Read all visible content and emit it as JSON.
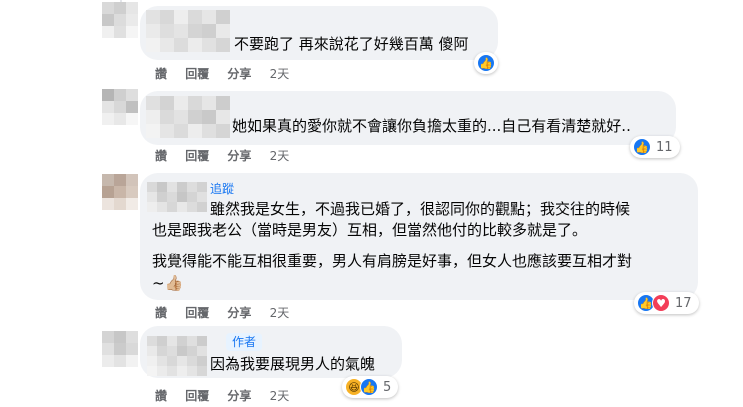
{
  "comments": [
    {
      "text_lines": [
        "不要跑了 再來說花了好幾百萬 傻阿"
      ],
      "actions": {
        "like": "讚",
        "reply": "回覆",
        "share": "分享",
        "time": "2天"
      },
      "reactions": {
        "icons": [
          "like-icon"
        ],
        "count": ""
      }
    },
    {
      "text_lines": [
        "她如果真的愛你就不會讓你負擔太重的...自己有看清楚就好.."
      ],
      "actions": {
        "like": "讚",
        "reply": "回覆",
        "share": "分享",
        "time": "2天"
      },
      "reactions": {
        "icons": [
          "like-icon"
        ],
        "count": "11"
      }
    },
    {
      "tag": "追蹤",
      "text_lines": [
        "雖然我是女生，不過我已婚了，很認同你的觀點；我交往的時候",
        "也是跟我老公（當時是男友）互相，但當然他付的比較多就是了。",
        "我覺得能不能互相很重要，男人有肩膀是好事，但女人也應該要互相才對",
        "~👍🏼"
      ],
      "actions": {
        "like": "讚",
        "reply": "回覆",
        "share": "分享",
        "time": "2天"
      },
      "reactions": {
        "icons": [
          "like-icon",
          "love-icon"
        ],
        "count": "17"
      }
    },
    {
      "badge": "作者",
      "text_lines": [
        "因為我要展現男人的氣魄"
      ],
      "actions": {
        "like": "讚",
        "reply": "回覆",
        "share": "分享",
        "time": "2天"
      },
      "reactions": {
        "icons": [
          "haha-icon",
          "like-icon"
        ],
        "count": "5"
      }
    }
  ],
  "colors": {
    "bubble": "#f0f2f5",
    "like": "#1877f2",
    "love": "#f33e58",
    "haha": "#f7b125",
    "meta_text": "#65676b"
  }
}
